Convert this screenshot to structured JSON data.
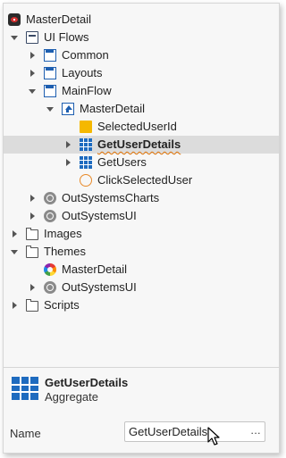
{
  "tree": {
    "root": "MasterDetail",
    "ui_flows": "UI Flows",
    "common": "Common",
    "layouts": "Layouts",
    "mainflow": "MainFlow",
    "masterdetail_screen": "MasterDetail",
    "selected_user_id": "SelectedUserId",
    "get_user_details": "GetUserDetails",
    "get_users": "GetUsers",
    "click_selected_user": "ClickSelectedUser",
    "outsystems_charts": "OutSystemsCharts",
    "outsystems_ui": "OutSystemsUI",
    "images": "Images",
    "themes": "Themes",
    "theme_masterdetail": "MasterDetail",
    "theme_outsystemsui": "OutSystemsUI",
    "scripts": "Scripts"
  },
  "properties": {
    "title": "GetUserDetails",
    "type": "Aggregate",
    "name_label": "Name",
    "name_value": "GetUserDetails",
    "more_button": "..."
  },
  "colors": {
    "selection": "#dcdcdc",
    "accent_blue": "#1e6bbf",
    "variable_yellow": "#f5b800",
    "action_orange": "#e88a2a"
  }
}
